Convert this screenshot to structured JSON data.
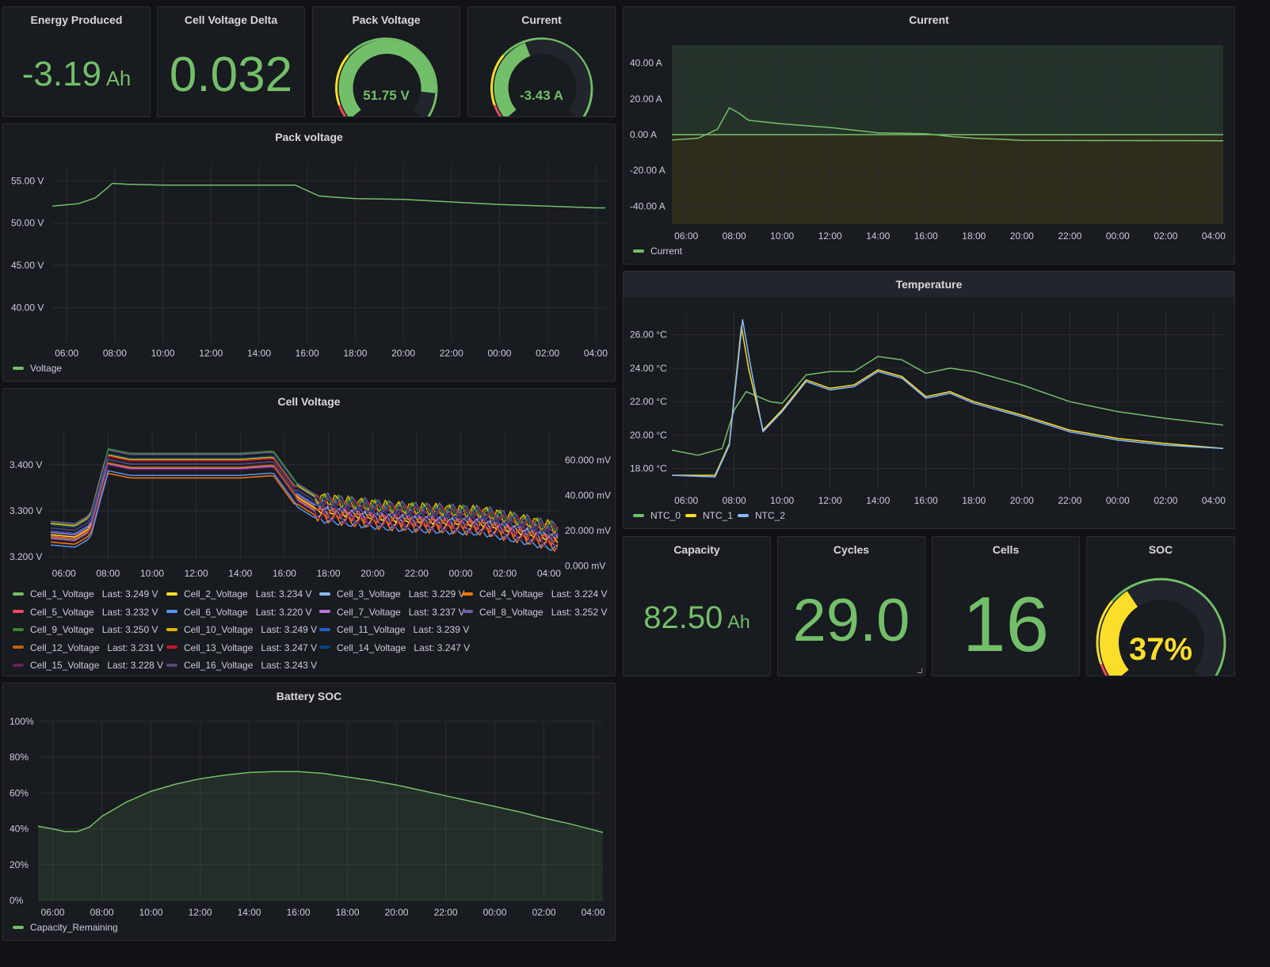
{
  "colors": {
    "green": "#73bf69",
    "yellow": "#fade2a",
    "red": "#f2495c",
    "blue": "#8ab8ff",
    "panel": "#181b1f",
    "background": "#111217"
  },
  "time_ticks": [
    "06:00",
    "08:00",
    "10:00",
    "12:00",
    "14:00",
    "16:00",
    "18:00",
    "20:00",
    "22:00",
    "00:00",
    "02:00",
    "04:00"
  ],
  "energy": {
    "title": "Energy Produced",
    "value": "-3.19",
    "unit": "Ah"
  },
  "cell_delta": {
    "title": "Cell Voltage Delta",
    "value": "0.032"
  },
  "pack_voltage_gauge": {
    "title": "Pack Voltage",
    "value": "51.75 V",
    "fraction": 0.87
  },
  "current_gauge": {
    "title": "Current",
    "value": "-3.43 A",
    "fraction": 0.42
  },
  "capacity": {
    "title": "Capacity",
    "value": "82.50",
    "unit": "Ah"
  },
  "cycles": {
    "title": "Cycles",
    "value": "29.0"
  },
  "cells": {
    "title": "Cells",
    "value": "16"
  },
  "soc_gauge": {
    "title": "SOC",
    "value": "37%",
    "fraction": 0.37
  },
  "pack_chart": {
    "title": "Pack voltage",
    "chart_data": {
      "type": "line",
      "x_unit": "hour of day",
      "y_ticks": [
        "55.00 V",
        "50.00 V",
        "45.00 V",
        "40.00 V"
      ],
      "ylim": [
        36,
        57
      ],
      "series": [
        {
          "name": "Voltage",
          "color": "#73bf69",
          "points": [
            [
              5.4,
              52.0
            ],
            [
              6.5,
              52.3
            ],
            [
              7.2,
              53.0
            ],
            [
              7.7,
              54.2
            ],
            [
              7.9,
              54.7
            ],
            [
              8.5,
              54.6
            ],
            [
              10,
              54.5
            ],
            [
              12,
              54.5
            ],
            [
              14,
              54.5
            ],
            [
              15.5,
              54.5
            ],
            [
              16.5,
              53.2
            ],
            [
              17.5,
              53.0
            ],
            [
              18,
              52.9
            ],
            [
              20,
              52.8
            ],
            [
              22,
              52.5
            ],
            [
              24,
              52.2
            ],
            [
              26,
              52.0
            ],
            [
              28,
              51.8
            ],
            [
              28.4,
              51.8
            ]
          ]
        }
      ]
    }
  },
  "current_chart": {
    "title": "Current",
    "chart_data": {
      "type": "line",
      "y_ticks": [
        "40.00 A",
        "20.00 A",
        "0.00 A",
        "-20.00 A",
        "-40.00 A"
      ],
      "ylim": [
        -50,
        50
      ],
      "series": [
        {
          "name": "Current",
          "color": "#73bf69",
          "points": [
            [
              5.4,
              -3
            ],
            [
              6.5,
              -2
            ],
            [
              7.3,
              3
            ],
            [
              7.8,
              15
            ],
            [
              8.2,
              12
            ],
            [
              8.6,
              8
            ],
            [
              10,
              6
            ],
            [
              12,
              4
            ],
            [
              14,
              1
            ],
            [
              16,
              0.5
            ],
            [
              17,
              -1
            ],
            [
              18,
              -2
            ],
            [
              19,
              -2.5
            ],
            [
              20,
              -3.2
            ],
            [
              24,
              -3.3
            ],
            [
              28.4,
              -3.4
            ]
          ]
        }
      ]
    }
  },
  "temp_chart": {
    "title": "Temperature",
    "chart_data": {
      "type": "line",
      "y_ticks": [
        "26.00 °C",
        "24.00 °C",
        "22.00 °C",
        "20.00 °C",
        "18.00 °C"
      ],
      "ylim": [
        16.8,
        27.5
      ],
      "series": [
        {
          "name": "NTC_0",
          "color": "#73bf69",
          "points": [
            [
              5.4,
              19.1
            ],
            [
              6.5,
              18.8
            ],
            [
              7.5,
              19.2
            ],
            [
              8,
              21.5
            ],
            [
              8.5,
              22.6
            ],
            [
              9.5,
              22.0
            ],
            [
              10,
              21.9
            ],
            [
              11,
              23.6
            ],
            [
              12,
              23.8
            ],
            [
              13,
              23.8
            ],
            [
              14,
              24.7
            ],
            [
              15,
              24.5
            ],
            [
              16,
              23.7
            ],
            [
              17,
              24.0
            ],
            [
              18,
              23.8
            ],
            [
              20,
              23.0
            ],
            [
              22,
              22.0
            ],
            [
              24,
              21.4
            ],
            [
              26,
              21.0
            ],
            [
              28.4,
              20.6
            ]
          ]
        },
        {
          "name": "NTC_1",
          "color": "#fade2a",
          "points": [
            [
              5.4,
              17.6
            ],
            [
              7.2,
              17.6
            ],
            [
              7.8,
              19.5
            ],
            [
              8.3,
              26.5
            ],
            [
              8.6,
              24
            ],
            [
              9.2,
              20.3
            ],
            [
              10,
              21.5
            ],
            [
              11,
              23.3
            ],
            [
              12,
              22.8
            ],
            [
              13,
              23.0
            ],
            [
              14,
              23.9
            ],
            [
              15,
              23.5
            ],
            [
              16,
              22.3
            ],
            [
              17,
              22.6
            ],
            [
              18,
              22.0
            ],
            [
              20,
              21.2
            ],
            [
              22,
              20.3
            ],
            [
              24,
              19.8
            ],
            [
              26,
              19.5
            ],
            [
              28.4,
              19.2
            ]
          ]
        },
        {
          "name": "NTC_2",
          "color": "#8ab8ff",
          "points": [
            [
              5.4,
              17.6
            ],
            [
              7.2,
              17.5
            ],
            [
              7.8,
              19.4
            ],
            [
              8.35,
              26.9
            ],
            [
              8.7,
              24
            ],
            [
              9.2,
              20.2
            ],
            [
              10,
              21.4
            ],
            [
              11,
              23.2
            ],
            [
              12,
              22.7
            ],
            [
              13,
              22.9
            ],
            [
              14,
              23.8
            ],
            [
              15,
              23.4
            ],
            [
              16,
              22.2
            ],
            [
              17,
              22.5
            ],
            [
              18,
              21.9
            ],
            [
              20,
              21.1
            ],
            [
              22,
              20.2
            ],
            [
              24,
              19.7
            ],
            [
              26,
              19.4
            ],
            [
              28.4,
              19.2
            ]
          ]
        }
      ]
    }
  },
  "cell_chart": {
    "title": "Cell Voltage",
    "chart_data": {
      "type": "line",
      "y_ticks": [
        "3.400 V",
        "3.300 V",
        "3.200 V"
      ],
      "y2_ticks": [
        "60.000 mV",
        "40.000 mV",
        "20.000 mV",
        "0.000 mV"
      ],
      "ylim": [
        3.19,
        3.47
      ],
      "series": [
        {
          "name": "Cell_1_Voltage",
          "color": "#73bf69",
          "last": "Last: 3.249 V"
        },
        {
          "name": "Cell_2_Voltage",
          "color": "#fade2a",
          "last": "Last: 3.234 V"
        },
        {
          "name": "Cell_3_Voltage",
          "color": "#8ab8ff",
          "last": "Last: 3.229 V"
        },
        {
          "name": "Cell_4_Voltage",
          "color": "#ff780a",
          "last": "Last: 3.224 V"
        },
        {
          "name": "Cell_5_Voltage",
          "color": "#f2495c",
          "last": "Last: 3.232 V"
        },
        {
          "name": "Cell_6_Voltage",
          "color": "#5794f2",
          "last": "Last: 3.220 V"
        },
        {
          "name": "Cell_7_Voltage",
          "color": "#b877d9",
          "last": "Last: 3.237 V"
        },
        {
          "name": "Cell_8_Voltage",
          "color": "#705da0",
          "last": "Last: 3.252 V"
        },
        {
          "name": "Cell_9_Voltage",
          "color": "#37872d",
          "last": "Last: 3.250 V"
        },
        {
          "name": "Cell_10_Voltage",
          "color": "#e0b400",
          "last": "Last: 3.249 V"
        },
        {
          "name": "Cell_11_Voltage",
          "color": "#1f60c4",
          "last": "Last: 3.239 V"
        },
        {
          "name": "Cell_12_Voltage",
          "color": "#c4620d",
          "last": "Last: 3.231 V"
        },
        {
          "name": "Cell_13_Voltage",
          "color": "#c4162a",
          "last": "Last: 3.247 V"
        },
        {
          "name": "Cell_14_Voltage",
          "color": "#0a437c",
          "last": "Last: 3.247 V"
        },
        {
          "name": "Cell_15_Voltage",
          "color": "#6d1f62",
          "last": "Last: 3.228 V"
        },
        {
          "name": "Cell_16_Voltage",
          "color": "#584477",
          "last": "Last: 3.243 V"
        }
      ]
    }
  },
  "soc_chart": {
    "title": "Battery SOC",
    "chart_data": {
      "type": "line",
      "y_ticks": [
        "100%",
        "80%",
        "60%",
        "40%",
        "20%",
        "0%"
      ],
      "ylim": [
        0,
        100
      ],
      "series": [
        {
          "name": "Capacity_Remaining",
          "color": "#73bf69",
          "points": [
            [
              5.4,
              41.5
            ],
            [
              6,
              40
            ],
            [
              6.5,
              38.5
            ],
            [
              7.0,
              38.5
            ],
            [
              7.5,
              41
            ],
            [
              8,
              47
            ],
            [
              9,
              55
            ],
            [
              10,
              61
            ],
            [
              11,
              65
            ],
            [
              12,
              68
            ],
            [
              13,
              70
            ],
            [
              14,
              71.5
            ],
            [
              15,
              72
            ],
            [
              16,
              72
            ],
            [
              17,
              71
            ],
            [
              18,
              69
            ],
            [
              19,
              67
            ],
            [
              20,
              64.5
            ],
            [
              21,
              61.5
            ],
            [
              22,
              58.5
            ],
            [
              23,
              55.5
            ],
            [
              24,
              52.5
            ],
            [
              25,
              49.5
            ],
            [
              26,
              46
            ],
            [
              27,
              43
            ],
            [
              28,
              39.5
            ],
            [
              28.4,
              38
            ]
          ]
        }
      ]
    }
  }
}
